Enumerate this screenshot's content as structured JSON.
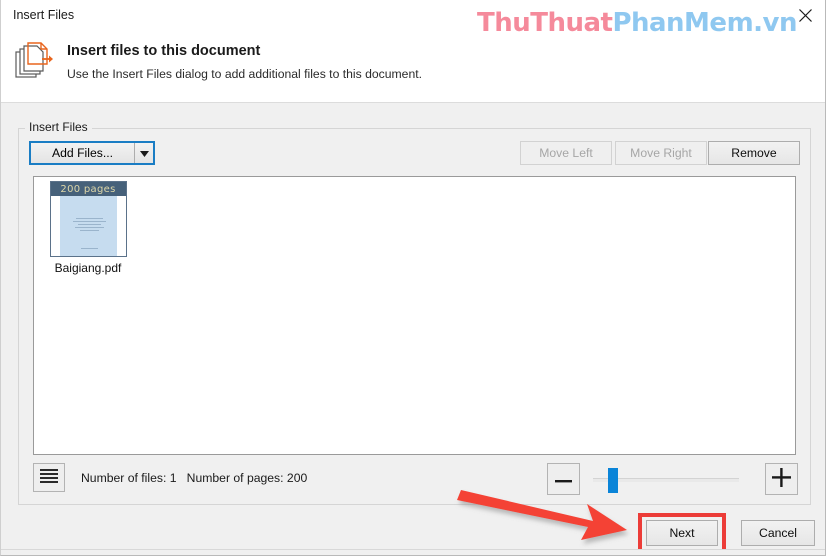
{
  "window": {
    "title": "Insert Files",
    "close_icon": "close-icon"
  },
  "watermark": {
    "part_a": "ThuThuat",
    "part_b": "PhanMem.vn",
    "color_a": "#f58a9b",
    "color_b": "#8fc8f0"
  },
  "header": {
    "icon": "insert-files-icon",
    "heading": "Insert files to this document",
    "subtitle": "Use the Insert Files dialog to add additional files to this document."
  },
  "group": {
    "legend": "Insert Files"
  },
  "toolbar": {
    "add_files_label": "Add Files...",
    "add_files_dropdown_icon": "chevron-down-icon",
    "move_left_label": "Move Left",
    "move_left_disabled": true,
    "move_right_label": "Move Right",
    "move_right_disabled": true,
    "remove_label": "Remove",
    "focus_color": "#1a7dc4"
  },
  "file_list": {
    "items": [
      {
        "badge": "200 pages",
        "name": "Baigiang.pdf",
        "badge_bg": "#46617a",
        "badge_fg": "#ddd6a8"
      }
    ]
  },
  "status": {
    "view_toggle_icon": "list-view-icon",
    "text": "Number of files: 1   Number of pages: 200",
    "files_count": "1",
    "pages_count": "200"
  },
  "zoom": {
    "minus_icon": "minus-icon",
    "plus_icon": "plus-icon",
    "slider_icon": "zoom-slider",
    "slider_value": "10",
    "slider_min": "0",
    "slider_max": "100"
  },
  "footer": {
    "next_label": "Next",
    "cancel_label": "Cancel"
  },
  "annotation": {
    "arrow": "red-arrow-pointing-to-next-button",
    "highlight": "red-rectangle-around-next-button",
    "color": "#ec3c38"
  }
}
